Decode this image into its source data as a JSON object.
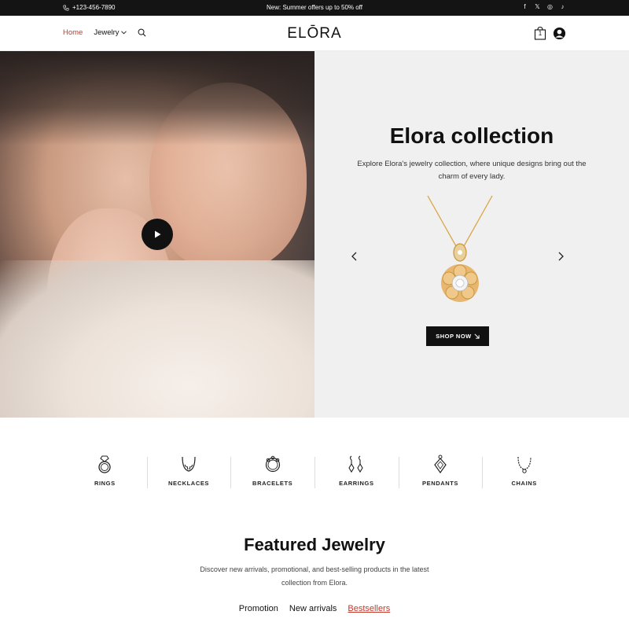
{
  "topbar": {
    "phone": "+123-456-7890",
    "promo": "New: Summer offers up to 50% off",
    "social": [
      "facebook-icon",
      "x-icon",
      "instagram-icon",
      "tiktok-icon"
    ]
  },
  "header": {
    "nav": {
      "home": "Home",
      "jewelry": "Jewelry"
    },
    "logo": "ELŌRA",
    "cart_count": "1",
    "accent_color": "#c0392b"
  },
  "hero": {
    "title": "Elora collection",
    "subtitle": "Explore Elora's jewelry collection, where unique designs bring out the charm of every lady.",
    "cta": "SHOP NOW"
  },
  "categories": [
    {
      "label": "RINGS",
      "icon": "ring-icon"
    },
    {
      "label": "NECKLACES",
      "icon": "necklace-icon"
    },
    {
      "label": "BRACELETS",
      "icon": "bracelet-icon"
    },
    {
      "label": "EARRINGS",
      "icon": "earrings-icon"
    },
    {
      "label": "PENDANTS",
      "icon": "pendant-icon"
    },
    {
      "label": "CHAINS",
      "icon": "chain-icon"
    }
  ],
  "featured": {
    "title": "Featured Jewelry",
    "subtitle": "Discover new arrivals, promotional, and best-selling products in the latest collection from Elora.",
    "tabs": [
      "Promotion",
      "New arrivals",
      "Bestsellers"
    ],
    "active_tab": "Bestsellers"
  }
}
